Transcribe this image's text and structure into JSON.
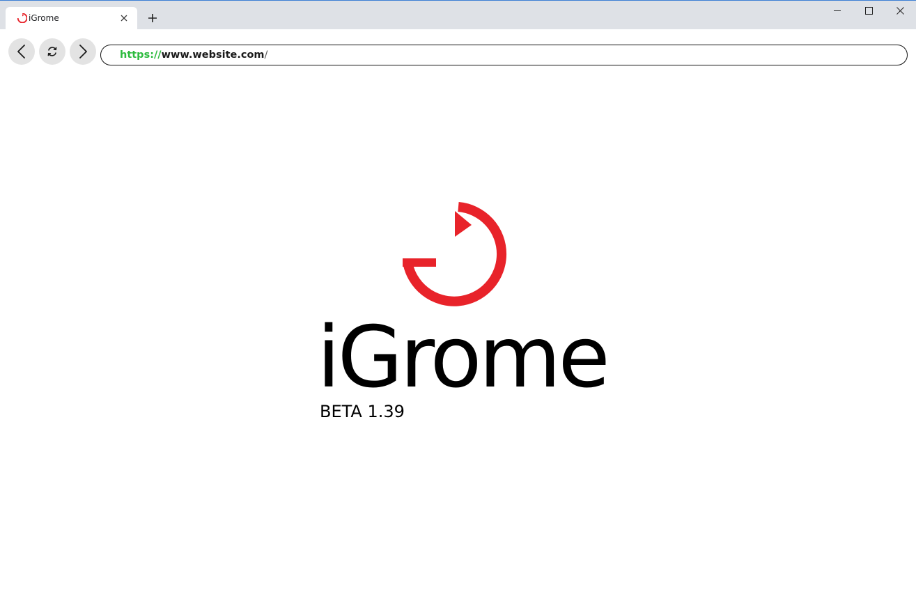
{
  "colors": {
    "accent_red": "#e8232a",
    "url_scheme_green": "#2dbb3e",
    "tabstrip_bg": "#dee1e6",
    "nav_button_bg": "#e3e3e3"
  },
  "tab": {
    "title": "iGrome",
    "favicon": "igrome-logo-icon",
    "close_icon": "close-icon"
  },
  "new_tab_icon": "plus-icon",
  "window_controls": {
    "minimize_icon": "minimize-icon",
    "maximize_icon": "maximize-icon",
    "close_icon": "close-icon"
  },
  "toolbar": {
    "back_icon": "chevron-left-icon",
    "reload_icon": "reload-icon",
    "forward_icon": "chevron-right-icon"
  },
  "address": {
    "scheme": "https://",
    "host": "www.website.com",
    "path": "/"
  },
  "page": {
    "logo_icon": "igrome-logo-icon",
    "brand_name": "iGrome",
    "version": "BETA 1.39"
  }
}
